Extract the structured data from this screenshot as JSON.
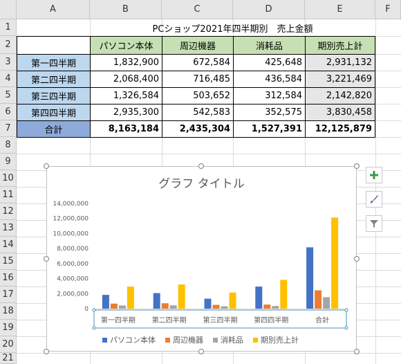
{
  "columns": [
    "A",
    "B",
    "C",
    "D",
    "E",
    "F"
  ],
  "rows": [
    "1",
    "2",
    "3",
    "4",
    "5",
    "6",
    "7",
    "8",
    "9",
    "10",
    "11",
    "12",
    "13",
    "14",
    "15",
    "16",
    "17",
    "18",
    "19",
    "20",
    "21"
  ],
  "title": "PCショップ2021年四半期別　売上金額",
  "headers": [
    "パソコン本体",
    "周辺機器",
    "消耗品",
    "期別売上計"
  ],
  "quarters": [
    {
      "label": "第一四半期",
      "vals": [
        "1,832,900",
        "672,584",
        "425,648",
        "2,931,132"
      ]
    },
    {
      "label": "第二四半期",
      "vals": [
        "2,068,400",
        "716,485",
        "436,584",
        "3,221,469"
      ]
    },
    {
      "label": "第三四半期",
      "vals": [
        "1,326,584",
        "503,652",
        "312,584",
        "2,142,820"
      ]
    },
    {
      "label": "第四四半期",
      "vals": [
        "2,935,300",
        "542,583",
        "352,575",
        "3,830,458"
      ]
    }
  ],
  "total": {
    "label": "合計",
    "vals": [
      "8,163,184",
      "2,435,304",
      "1,527,391",
      "12,125,879"
    ]
  },
  "colors": {
    "pc": "#4472c4",
    "periph": "#ed7d31",
    "consum": "#a5a5a5",
    "sum": "#ffc000"
  },
  "chart_data": {
    "type": "bar",
    "title": "グラフ タイトル",
    "categories": [
      "第一四半期",
      "第二四半期",
      "第三四半期",
      "第四四半期",
      "合計"
    ],
    "series": [
      {
        "name": "パソコン本体",
        "values": [
          1832900,
          2068400,
          1326584,
          2935300,
          8163184
        ]
      },
      {
        "name": "周辺機器",
        "values": [
          672584,
          716485,
          503652,
          542583,
          2435304
        ]
      },
      {
        "name": "消耗品",
        "values": [
          425648,
          436584,
          312584,
          352575,
          1527391
        ]
      },
      {
        "name": "期別売上計",
        "values": [
          2931132,
          3221469,
          2142820,
          3830458,
          12125879
        ]
      }
    ],
    "ylim": [
      0,
      14000000
    ],
    "yticks": [
      "0",
      "2,000,000",
      "4,000,000",
      "6,000,000",
      "8,000,000",
      "10,000,000",
      "12,000,000",
      "14,000,000"
    ],
    "legend_position": "bottom",
    "grid": false
  }
}
